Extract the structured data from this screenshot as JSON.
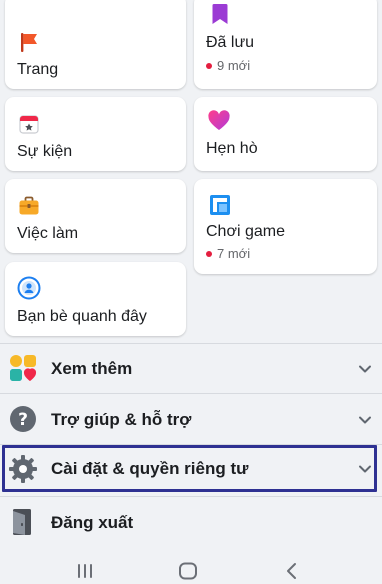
{
  "tiles": {
    "trang": {
      "label": "Trang"
    },
    "da_luu": {
      "label": "Đã lưu",
      "sub": "9 mới"
    },
    "su_kien": {
      "label": "Sự kiện"
    },
    "hen_ho": {
      "label": "Hẹn hò"
    },
    "viec_lam": {
      "label": "Việc làm"
    },
    "choi_game": {
      "label": "Chơi game",
      "sub": "7 mới"
    },
    "ban_be": {
      "label": "Bạn bè quanh đây"
    }
  },
  "menu": {
    "xem_them": "Xem thêm",
    "tro_giup": "Trợ giúp & hỗ trợ",
    "cai_dat": "Cài đặt & quyền riêng tư",
    "dang_xuat": "Đăng xuất"
  },
  "colors": {
    "highlight": "#2e3192",
    "notification_dot": "#e41e3f",
    "background": "#f0f2f5"
  }
}
